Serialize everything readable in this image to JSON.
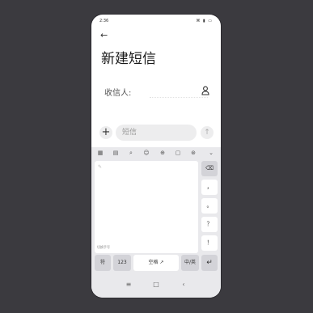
{
  "status_bar": {
    "time": "2:36",
    "icons": "⌘ ▮ ▭"
  },
  "header": {
    "back_glyph": "←",
    "title": "新建短信"
  },
  "recipient": {
    "label": "收信人:"
  },
  "compose": {
    "plus_glyph": "+",
    "placeholder": "短信",
    "send_glyph": "↑"
  },
  "keyboard": {
    "toolbar_icons": [
      "▦",
      "▤",
      "⌕",
      "☺",
      "⊕",
      "▢",
      "⊛",
      "⌄"
    ],
    "handwrite_mark": "✎",
    "handwrite_hint": "切换手写",
    "right_keys": [
      "⌫",
      "，",
      "。",
      "？",
      "！"
    ],
    "bottom_keys": {
      "symbols": "符",
      "numbers": "123",
      "space": "空格 ↗",
      "lang": "中/英",
      "enter": "↵"
    }
  },
  "nav": {
    "menu": "≡",
    "home": "□",
    "back": "‹"
  }
}
